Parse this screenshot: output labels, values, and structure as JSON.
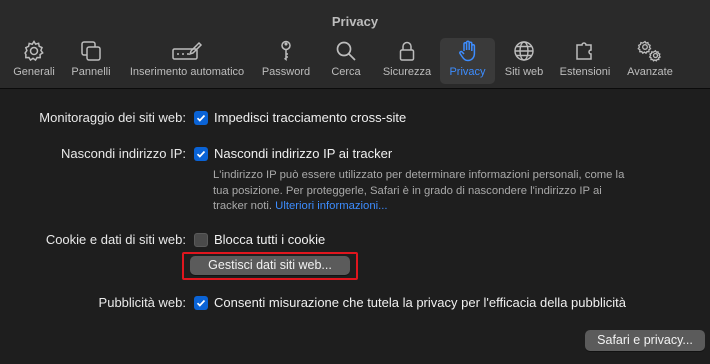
{
  "window": {
    "title": "Privacy"
  },
  "tabs": [
    {
      "label": "Generali",
      "icon": "gear-icon"
    },
    {
      "label": "Pannelli",
      "icon": "tabs-icon"
    },
    {
      "label": "Inserimento automatico",
      "icon": "autofill-pencil-icon"
    },
    {
      "label": "Password",
      "icon": "key-icon"
    },
    {
      "label": "Cerca",
      "icon": "magnifier-icon"
    },
    {
      "label": "Sicurezza",
      "icon": "lock-icon"
    },
    {
      "label": "Privacy",
      "icon": "hand-icon",
      "active": true
    },
    {
      "label": "Siti web",
      "icon": "globe-icon"
    },
    {
      "label": "Estensioni",
      "icon": "puzzle-icon"
    },
    {
      "label": "Avanzate",
      "icon": "gears-icon"
    }
  ],
  "settings": {
    "tracking": {
      "label": "Monitoraggio dei siti web:",
      "checkbox": "Impedisci tracciamento cross-site",
      "checked": true
    },
    "hide_ip": {
      "label": "Nascondi indirizzo IP:",
      "checkbox": "Nascondi indirizzo IP ai tracker",
      "checked": true,
      "note_line1": "L'indirizzo IP può essere utilizzato per determinare informazioni personali, come la",
      "note_line2": "tua posizione. Per proteggerle, Safari è in grado di nascondere l'indirizzo IP ai",
      "note_line3": "tracker noti.",
      "note_link": "Ulteriori informazioni..."
    },
    "cookies": {
      "label": "Cookie e dati di siti web:",
      "checkbox": "Blocca tutti i cookie",
      "checked": false,
      "manage_button": "Gestisci dati siti web..."
    },
    "ads": {
      "label": "Pubblicità web:",
      "checkbox": "Consenti misurazione che tutela la privacy per l'efficacia della pubblicità",
      "checked": true
    }
  },
  "footer": {
    "button": "Safari e privacy..."
  },
  "colors": {
    "accent": "#0a63d6",
    "highlight": "#e0161e",
    "background": "#1e1e1e"
  }
}
